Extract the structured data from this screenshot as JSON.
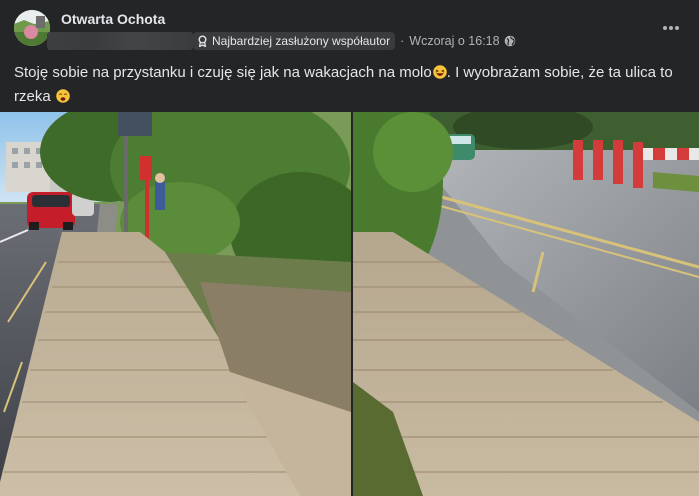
{
  "post": {
    "group_name": "Otwarta Ochota",
    "badge_label": "Najbardziej zasłużony współautor",
    "separator": "·",
    "timestamp": "Wczoraj o 16:18",
    "text_part1": "Stoję sobie na przystanku i czuję się jak na wakacjach na molo",
    "text_part2": ". I wyobrażam sobie, że ta ulica to rzeka",
    "emojis": [
      "laughing-emoji",
      "weary-emoji"
    ],
    "privacy_icon": "globe-icon",
    "menu_icon": "more-options-icon"
  },
  "images": [
    {
      "label": "photo-bus-stop-wooden-platform"
    },
    {
      "label": "photo-wooden-platform-by-road"
    }
  ],
  "colors": {
    "background": "#242526",
    "primary_text": "#e4e6eb",
    "secondary_text": "#b0b3b8",
    "badge_bg": "#3a3b3c"
  }
}
